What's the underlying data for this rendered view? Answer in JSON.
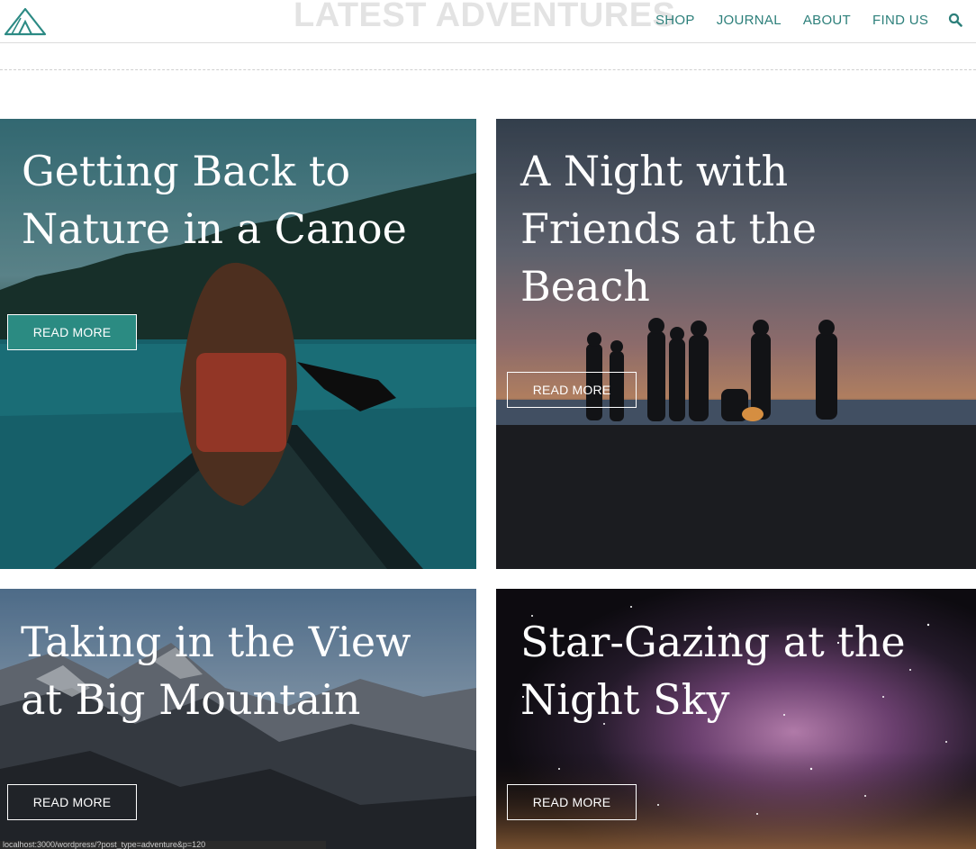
{
  "header": {
    "title": "LATEST ADVENTURES",
    "nav": [
      "SHOP",
      "JOURNAL",
      "ABOUT",
      "FIND US"
    ],
    "logo_icon": "tent-icon",
    "search_icon": "search-icon"
  },
  "cards": [
    {
      "title": "Getting Back to\nNature in a Canoe",
      "button": "READ MORE"
    },
    {
      "title": "A Night with\nFriends at the\nBeach",
      "button": "READ MORE"
    },
    {
      "title": "Taking in the View\nat Big Mountain",
      "button": "READ MORE"
    },
    {
      "title": "Star-Gazing at the\nNight Sky",
      "button": "READ MORE"
    }
  ],
  "status_bar": {
    "url": "localhost:3000/wordpress/?post_type=adventure&p=120"
  },
  "colors": {
    "accent": "#2b8b82",
    "nav_text": "#2c7f7a",
    "title_faded": "#e3e3e3"
  }
}
